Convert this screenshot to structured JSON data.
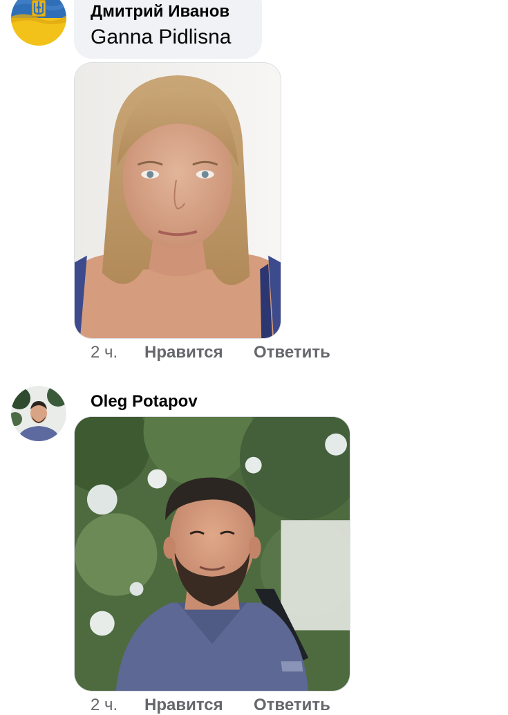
{
  "comments": [
    {
      "author": "Дмитрий Иванов",
      "text": "Ganna Pidlisna",
      "time": "2 ч.",
      "like_label": "Нравится",
      "reply_label": "Ответить",
      "avatar_icon": "ukraine-flag-trident-avatar"
    },
    {
      "author": "Oleg Potapov",
      "text": "",
      "time": "2 ч.",
      "like_label": "Нравится",
      "reply_label": "Ответить",
      "avatar_icon": "man-portrait-avatar"
    }
  ],
  "colors": {
    "bubble_bg": "#f0f2f5",
    "meta_text": "#65676b",
    "name_text": "#050505"
  }
}
